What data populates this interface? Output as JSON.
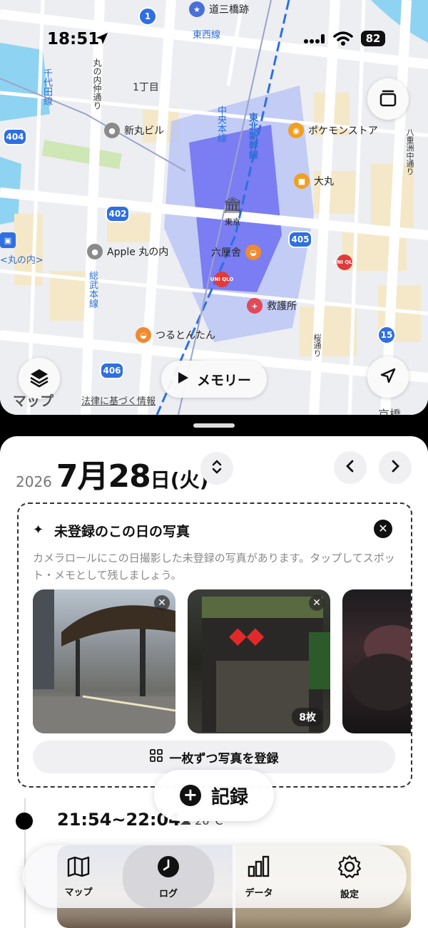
{
  "status_bar": {
    "time": "18:51",
    "battery": "82"
  },
  "map": {
    "pins": {
      "dosanbashi": "道三橋跡",
      "shinmaru": "新丸ビル",
      "pokemon": "ポケモンストア",
      "daimaru": "大丸",
      "tokyo": "東京",
      "rokurinsha": "六厘舎",
      "apple": "Apple 丸の内",
      "kyugo": "救護所",
      "tsurutontan": "つるとんたん",
      "uniqlo": "UNI QLO",
      "marunouchi": "<丸の内>"
    },
    "labels": {
      "tozai": "東西線",
      "chiyoda": "千代田線",
      "marunouchi_naka": "丸の内仲通り",
      "itchome": "1丁目",
      "chuo": "中央本線",
      "tohoku": "東北新幹線",
      "sobu": "総武本線",
      "yaesu": "八重洲中通り",
      "kyobashi": "京橋",
      "east": "桜通り"
    },
    "routes": {
      "r1": "1",
      "r404": "404",
      "r402": "402",
      "r405": "405",
      "r406": "406",
      "r15": "15"
    },
    "memory_label": "メモリー",
    "map_logo": "マップ",
    "legal": "法律に基づく情報"
  },
  "date_header": {
    "year": "2026",
    "month_day": "7月28",
    "weekday": "日(火)"
  },
  "unregistered": {
    "title": "未登録のこの日の写真",
    "description": "カメラロールにこの日撮影した未登録の写真があります。タップしてスポット・メモとして残しましょう。",
    "photo_count": "8枚",
    "register_label": "一枚ずつ写真を登録"
  },
  "record_label": "記録",
  "entry": {
    "time": "21:54~22:04",
    "weather": "26°C"
  },
  "tabs": [
    {
      "label": "マップ",
      "icon": "map-icon"
    },
    {
      "label": "ログ",
      "icon": "clock-icon"
    },
    {
      "label": "データ",
      "icon": "chart-icon"
    },
    {
      "label": "設定",
      "icon": "gear-icon"
    }
  ],
  "colors": {
    "route_blue": "#2f6fe0",
    "station_purple": "#6f6ef2",
    "accent_black": "#111111"
  }
}
